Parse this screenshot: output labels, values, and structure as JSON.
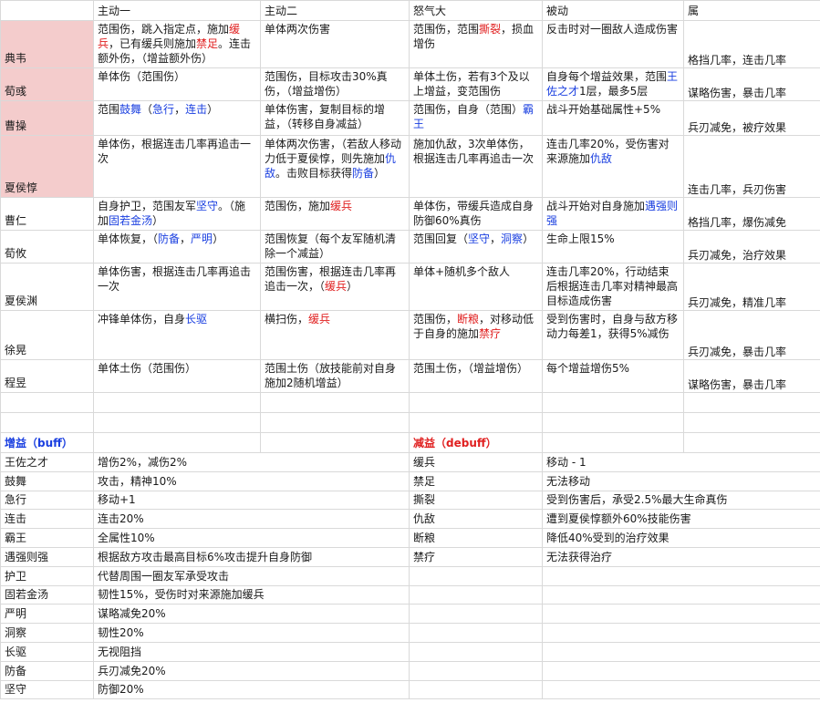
{
  "headers": [
    "",
    "主动一",
    "主动二",
    "怒气大",
    "被动",
    "属"
  ],
  "heroes": [
    {
      "name": "典韦",
      "skill1": [
        {
          "t": "范围伤，跳入指定点，施加"
        },
        {
          "t": "缓兵",
          "c": "red"
        },
        {
          "t": "，已有缓兵则施加"
        },
        {
          "t": "禁足",
          "c": "red"
        },
        {
          "t": "。连击额外伤，（增益额外伤）"
        }
      ],
      "skill2": [
        {
          "t": "单体两次伤害"
        }
      ],
      "rage": [
        {
          "t": "范围伤，范围"
        },
        {
          "t": "撕裂",
          "c": "red"
        },
        {
          "t": "，损血增伤"
        }
      ],
      "passive": [
        {
          "t": "反击时对一圈敌人造成伤害"
        }
      ],
      "attr": "格挡几率，连击几率"
    },
    {
      "name": "荀彧",
      "skill1": [
        {
          "t": "单体伤（范围伤）"
        }
      ],
      "skill2": [
        {
          "t": "范围伤，目标攻击30%真伤，（增益增伤）"
        }
      ],
      "rage": [
        {
          "t": "单体土伤，若有3个及以上增益，变范围伤"
        }
      ],
      "passive": [
        {
          "t": "自身每个增益效果，范围"
        },
        {
          "t": "王佐之才",
          "c": "blue"
        },
        {
          "t": "1层，最多5层"
        }
      ],
      "attr": "谋略伤害，暴击几率"
    },
    {
      "name": "曹操",
      "skill1": [
        {
          "t": "范围"
        },
        {
          "t": "鼓舞",
          "c": "blue"
        },
        {
          "t": "（"
        },
        {
          "t": "急行",
          "c": "blue"
        },
        {
          "t": "，"
        },
        {
          "t": "连击",
          "c": "blue"
        },
        {
          "t": "）"
        }
      ],
      "skill2": [
        {
          "t": "单体伤害，复制目标的增益，（转移自身减益）"
        }
      ],
      "rage": [
        {
          "t": "范围伤，自身（范围）"
        },
        {
          "t": "霸王",
          "c": "blue"
        }
      ],
      "passive": [
        {
          "t": "战斗开始基础属性+5%"
        }
      ],
      "attr": "兵刃减免，被疗效果"
    },
    {
      "name": "夏侯惇",
      "skill1": [
        {
          "t": "单体伤，根据连击几率再追击一次"
        }
      ],
      "skill2": [
        {
          "t": "单体两次伤害，（若敌人移动力低于夏侯惇，则先施加"
        },
        {
          "t": "仇敌",
          "c": "blue"
        },
        {
          "t": "。击败目标获得"
        },
        {
          "t": "防备",
          "c": "blue"
        },
        {
          "t": "）"
        }
      ],
      "rage": [
        {
          "t": "施加仇敌，3次单体伤，根据连击几率再追击一次"
        }
      ],
      "passive": [
        {
          "t": "连击几率20%，受伤害对来源施加"
        },
        {
          "t": "仇敌",
          "c": "blue"
        }
      ],
      "attr": "连击几率，兵刃伤害"
    },
    {
      "name": "曹仁",
      "skill1": [
        {
          "t": "自身护卫，范围友军"
        },
        {
          "t": "坚守",
          "c": "blue"
        },
        {
          "t": "。（施加"
        },
        {
          "t": "固若金汤",
          "c": "blue"
        },
        {
          "t": "）"
        }
      ],
      "skill2": [
        {
          "t": "范围伤，施加"
        },
        {
          "t": "缓兵",
          "c": "red"
        }
      ],
      "rage": [
        {
          "t": "单体伤，带缓兵造成自身防御60%真伤"
        }
      ],
      "passive": [
        {
          "t": "战斗开始对自身施加"
        },
        {
          "t": "遇强则强",
          "c": "blue"
        }
      ],
      "attr": "格挡几率，爆伤减免"
    },
    {
      "name": "荀攸",
      "skill1": [
        {
          "t": "单体恢复，（"
        },
        {
          "t": "防备",
          "c": "blue"
        },
        {
          "t": "，"
        },
        {
          "t": "严明",
          "c": "blue"
        },
        {
          "t": "）"
        }
      ],
      "skill2": [
        {
          "t": "范围恢复（每个友军随机清除一个减益）"
        }
      ],
      "rage": [
        {
          "t": "范围回复（"
        },
        {
          "t": "坚守",
          "c": "blue"
        },
        {
          "t": "，"
        },
        {
          "t": "洞察",
          "c": "blue"
        },
        {
          "t": "）"
        }
      ],
      "passive": [
        {
          "t": "生命上限15%"
        }
      ],
      "attr": "兵刃减免，治疗效果"
    },
    {
      "name": "夏侯渊",
      "skill1": [
        {
          "t": "单体伤害，根据连击几率再追击一次"
        }
      ],
      "skill2": [
        {
          "t": "范围伤害，根据连击几率再追击一次，（"
        },
        {
          "t": "缓兵",
          "c": "red"
        },
        {
          "t": "）"
        }
      ],
      "rage": [
        {
          "t": "单体+随机多个敌人"
        }
      ],
      "passive": [
        {
          "t": "连击几率20%，行动结束后根据连击几率对精神最高目标造成伤害"
        }
      ],
      "attr": "兵刃减免，精准几率"
    },
    {
      "name": "徐晃",
      "skill1": [
        {
          "t": "冲锋单体伤，自身"
        },
        {
          "t": "长驱",
          "c": "blue"
        }
      ],
      "skill2": [
        {
          "t": "横扫伤，"
        },
        {
          "t": "缓兵",
          "c": "red"
        }
      ],
      "rage": [
        {
          "t": "范围伤，"
        },
        {
          "t": "断粮",
          "c": "red"
        },
        {
          "t": "，对移动低于自身的施加"
        },
        {
          "t": "禁疗",
          "c": "red"
        }
      ],
      "passive": [
        {
          "t": "受到伤害时，自身与敌方移动力每差1，获得5%减伤"
        }
      ],
      "attr": "兵刃减免，暴击几率"
    },
    {
      "name": "程昱",
      "skill1": [
        {
          "t": "单体土伤（范围伤）"
        }
      ],
      "skill2": [
        {
          "t": "范围土伤（放技能前对自身施加2随机增益）"
        }
      ],
      "rage": [
        {
          "t": "范围土伤，（增益增伤）"
        }
      ],
      "passive": [
        {
          "t": "每个增益增伤5%"
        }
      ],
      "attr": "谋略伤害，暴击几率"
    }
  ],
  "buff": {
    "title": "增益（buff）",
    "items": [
      {
        "name": "王佐之才",
        "desc": "增伤2%，减伤2%"
      },
      {
        "name": "鼓舞",
        "desc": "攻击，精神10%"
      },
      {
        "name": "急行",
        "desc": "移动+1"
      },
      {
        "name": "连击",
        "desc": "连击20%"
      },
      {
        "name": "霸王",
        "desc": "全属性10%"
      },
      {
        "name": "遇强则强",
        "desc": "根据敌方攻击最高目标6%攻击提升自身防御"
      },
      {
        "name": "护卫",
        "desc": "代替周围一圈友军承受攻击"
      },
      {
        "name": "固若金汤",
        "desc": "韧性15%，受伤时对来源施加缓兵"
      },
      {
        "name": "严明",
        "desc": "谋略减免20%"
      },
      {
        "name": "洞察",
        "desc": "韧性20%"
      },
      {
        "name": "长驱",
        "desc": "无视阻挡"
      },
      {
        "name": "防备",
        "desc": "兵刃减免20%"
      },
      {
        "name": "坚守",
        "desc": "防御20%"
      }
    ]
  },
  "debuff": {
    "title": "减益（debuff）",
    "items": [
      {
        "name": "缓兵",
        "desc": "移动 - 1"
      },
      {
        "name": "禁足",
        "desc": "无法移动"
      },
      {
        "name": "撕裂",
        "desc": "受到伤害后，承受2.5%最大生命真伤"
      },
      {
        "name": "仇敌",
        "desc": "遭到夏侯惇额外60%技能伤害"
      },
      {
        "name": "断粮",
        "desc": "降低40%受到的治疗效果"
      },
      {
        "name": "禁疗",
        "desc": "无法获得治疗"
      }
    ]
  }
}
